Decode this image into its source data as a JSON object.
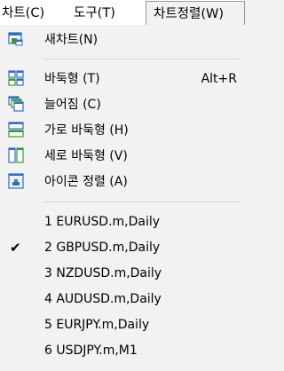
{
  "menubar": {
    "items": [
      {
        "label": "차트(C)"
      },
      {
        "label": "도구(T)"
      },
      {
        "label": "차트정렬(W)"
      }
    ]
  },
  "menu": {
    "new_chart": {
      "label": "새차트(N)",
      "icon": "new-chart-icon"
    },
    "tile": {
      "label": "바둑형 (T)",
      "shortcut": "Alt+R",
      "icon": "tile-windows-icon"
    },
    "cascade": {
      "label": "늘어짐 (C)",
      "icon": "cascade-windows-icon"
    },
    "tile_horizontal": {
      "label": "가로 바둑형 (H)",
      "icon": "tile-horizontal-icon"
    },
    "tile_vertical": {
      "label": "세로 바둑형 (V)",
      "icon": "tile-vertical-icon"
    },
    "arrange_icons": {
      "label": "아이콘 정렬 (A)",
      "icon": "arrange-icons-icon"
    },
    "windows": [
      {
        "label": "1 EURUSD.m,Daily",
        "checked": false
      },
      {
        "label": "2 GBPUSD.m,Daily",
        "checked": true
      },
      {
        "label": "3 NZDUSD.m,Daily",
        "checked": false
      },
      {
        "label": "4 AUDUSD.m,Daily",
        "checked": false
      },
      {
        "label": "5 EURJPY.m,Daily",
        "checked": false
      },
      {
        "label": "6 USDJPY.m,M1",
        "checked": false
      }
    ],
    "check_glyph": "✔"
  },
  "colors": {
    "icon_blue": "#2f6fc0",
    "icon_green": "#3a9a3a",
    "menu_bg": "#f2f2f2"
  }
}
